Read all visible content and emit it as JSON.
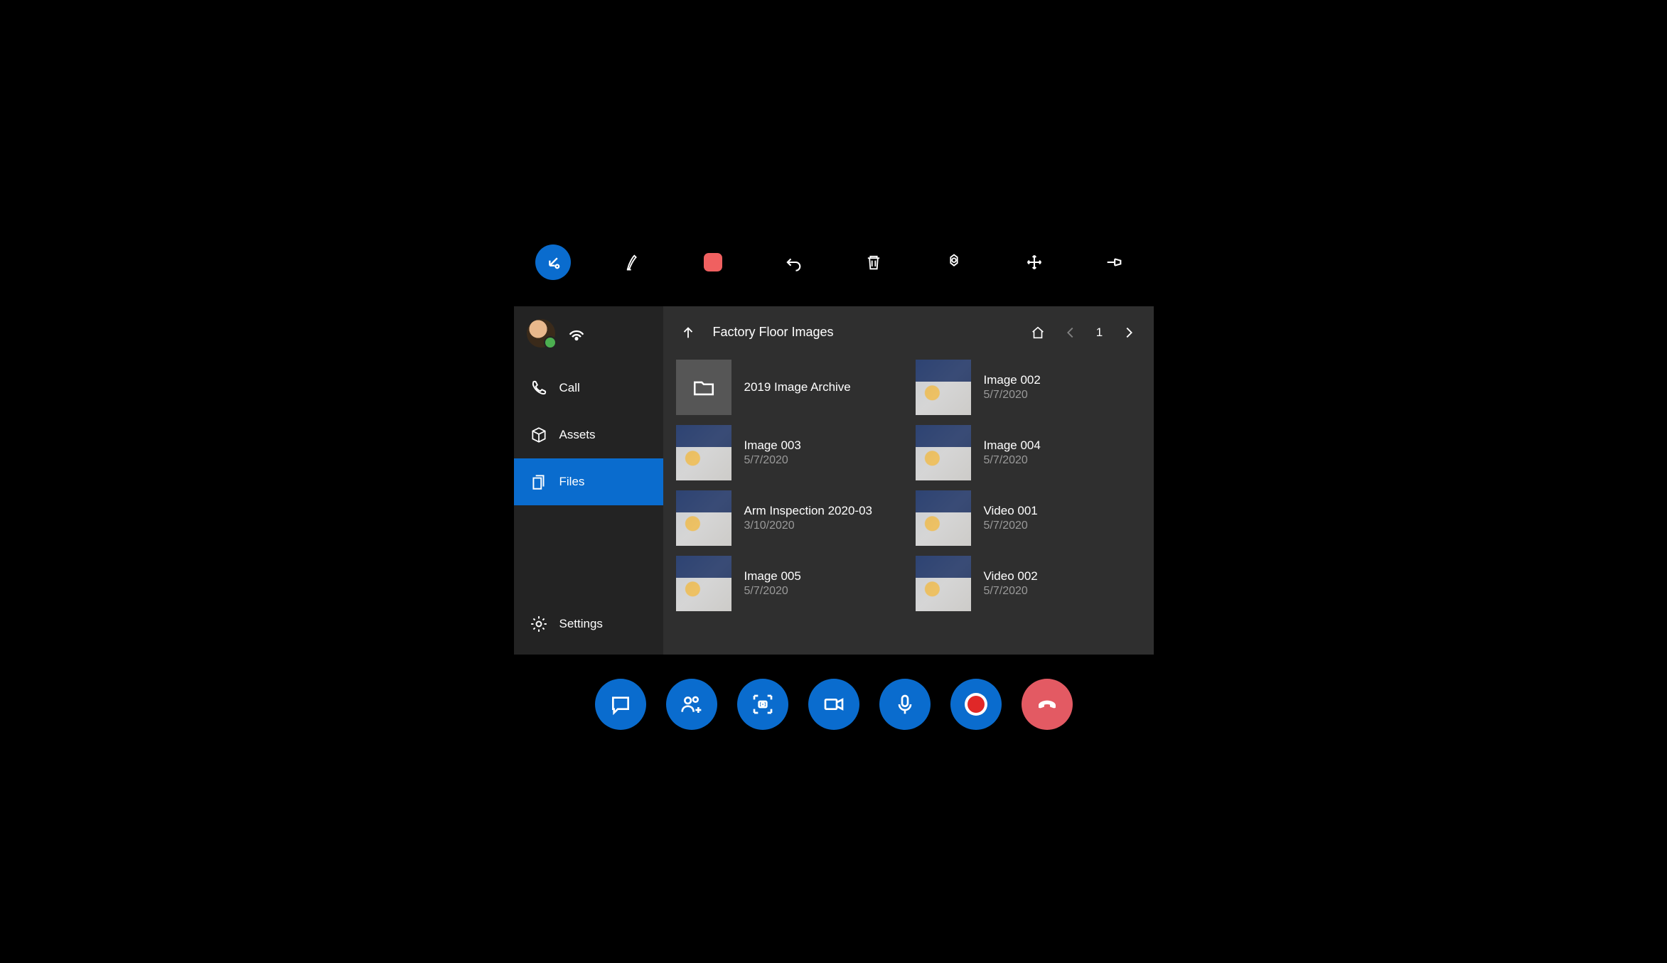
{
  "sidebar": {
    "items": [
      {
        "label": "Call"
      },
      {
        "label": "Assets"
      },
      {
        "label": "Files"
      },
      {
        "label": "Settings"
      }
    ]
  },
  "header": {
    "breadcrumb": "Factory Floor Images",
    "page": "1"
  },
  "files": [
    {
      "name": "2019 Image Archive",
      "date": "",
      "type": "folder"
    },
    {
      "name": "Image 002",
      "date": "5/7/2020",
      "type": "image"
    },
    {
      "name": "Image 003",
      "date": "5/7/2020",
      "type": "image"
    },
    {
      "name": "Image 004",
      "date": "5/7/2020",
      "type": "image"
    },
    {
      "name": "Arm Inspection 2020-03",
      "date": "3/10/2020",
      "type": "image"
    },
    {
      "name": "Video 001",
      "date": "5/7/2020",
      "type": "video"
    },
    {
      "name": "Image 005",
      "date": "5/7/2020",
      "type": "image"
    },
    {
      "name": "Video 002",
      "date": "5/7/2020",
      "type": "video"
    }
  ],
  "colors": {
    "accent": "#0a6cce",
    "hangup": "#e35a63",
    "ink": "#f06060"
  }
}
